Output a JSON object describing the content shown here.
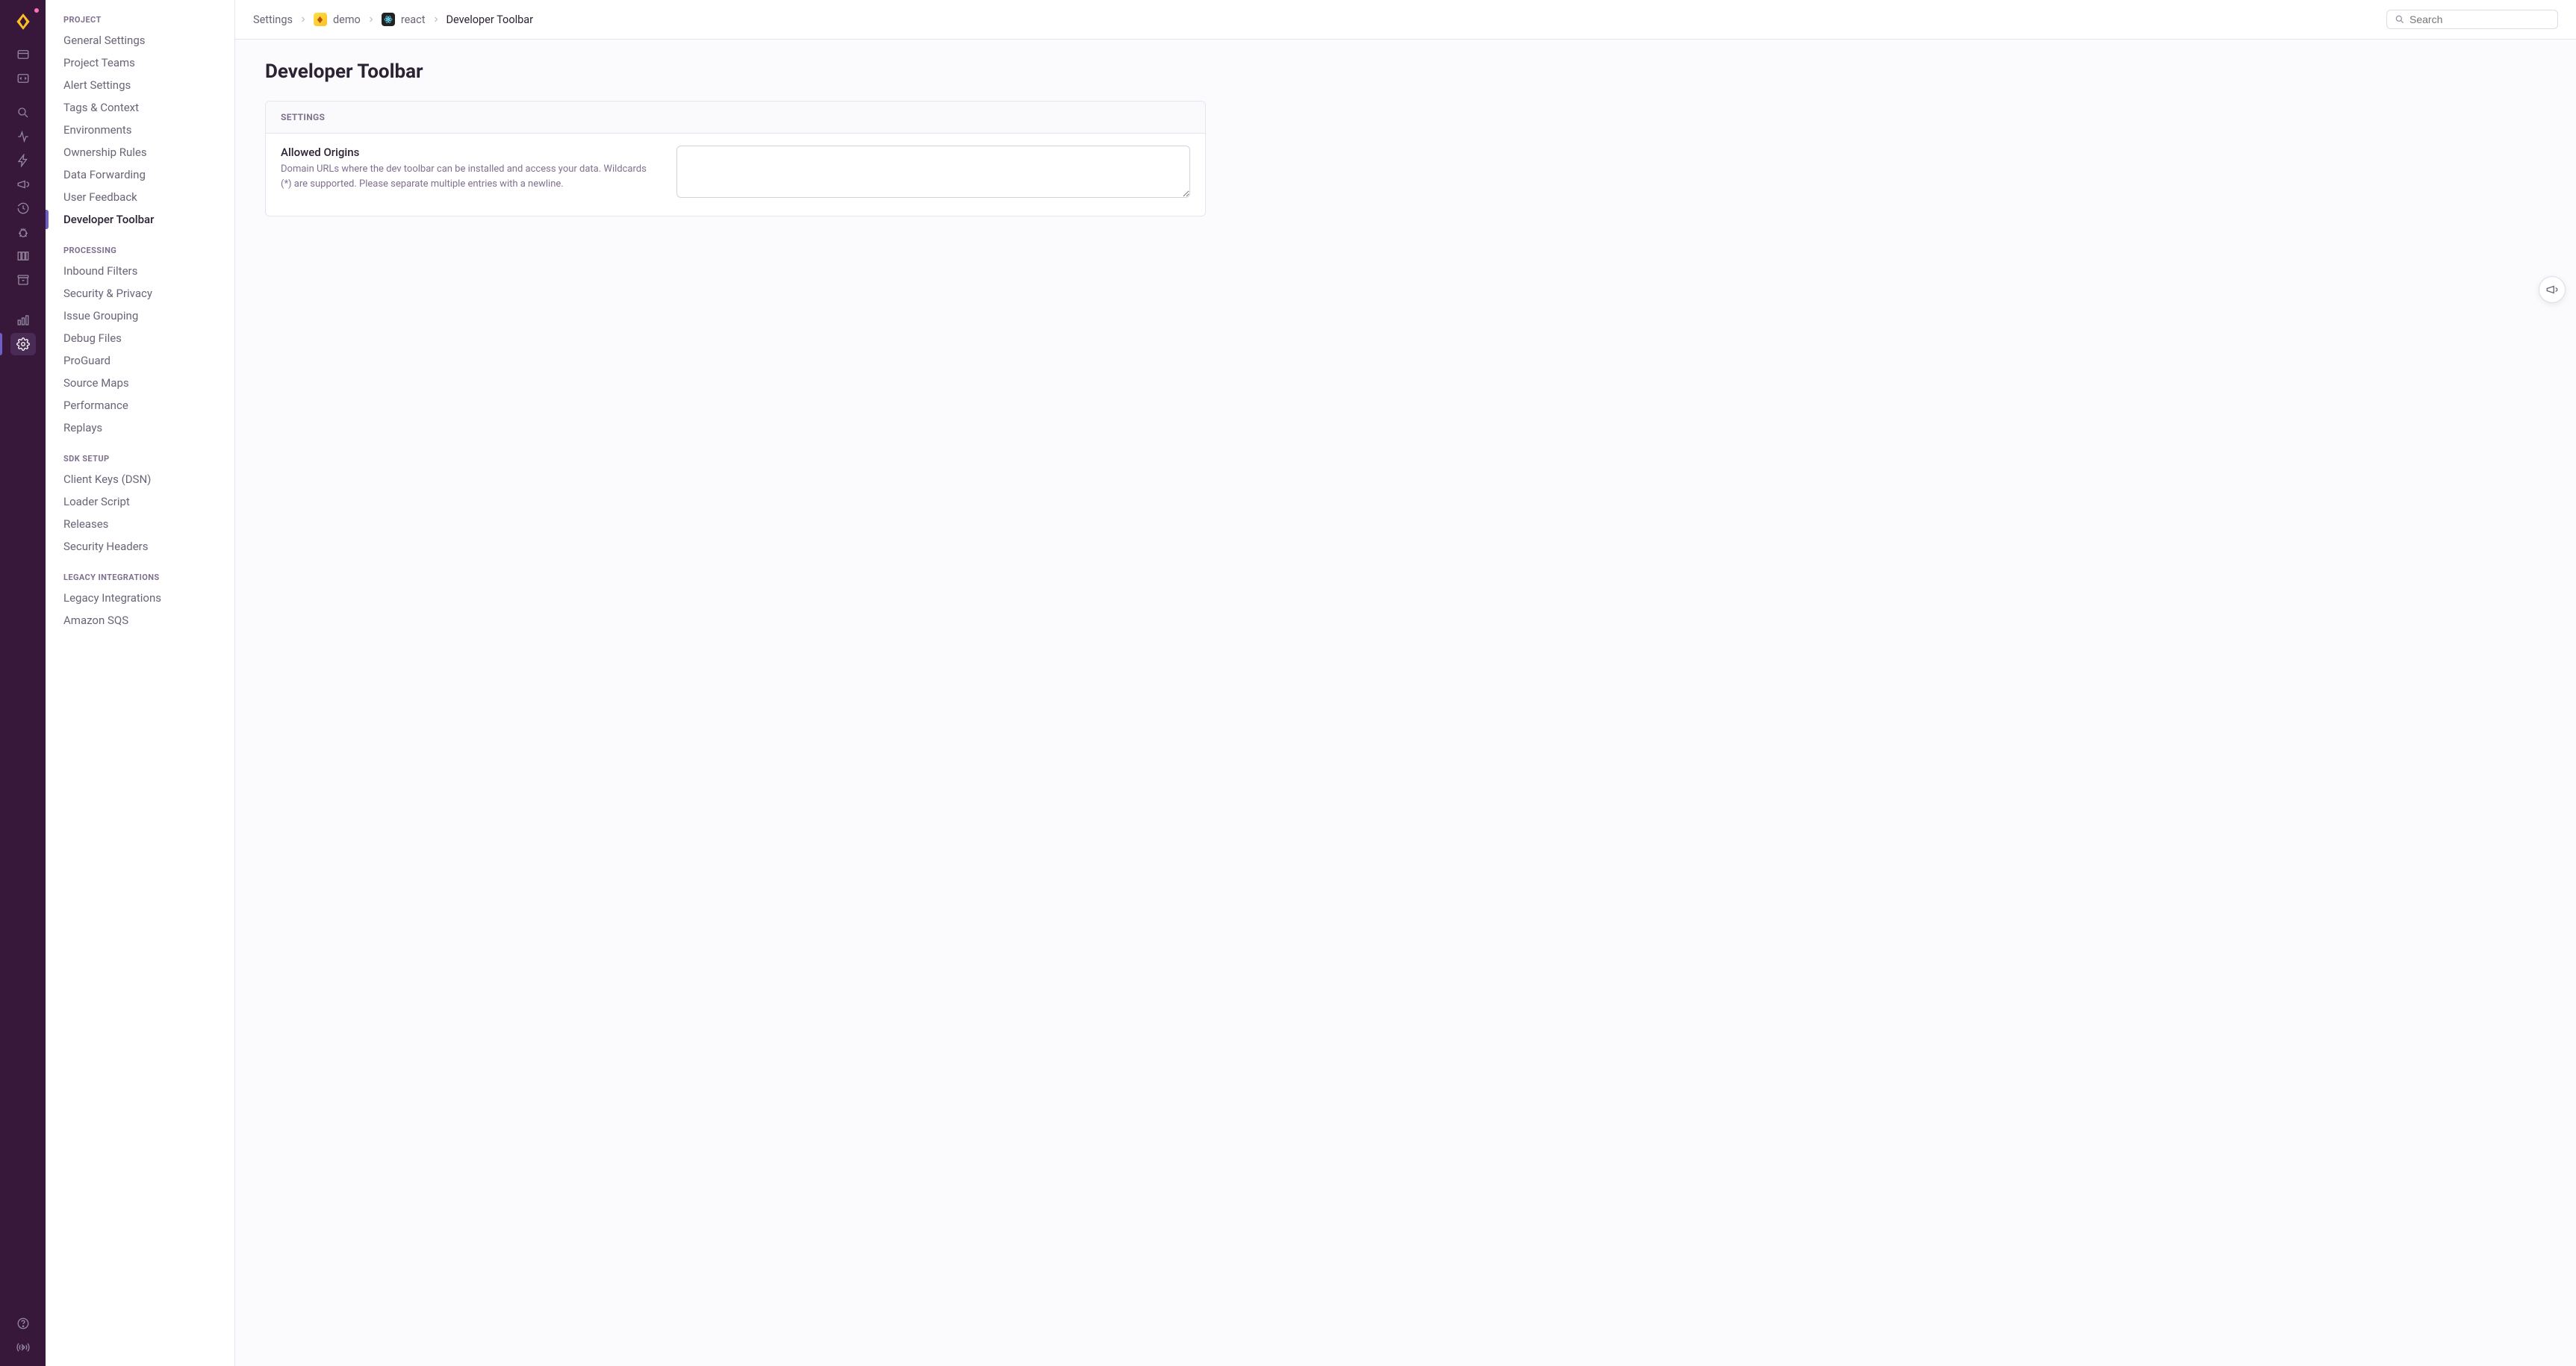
{
  "breadcrumbs": {
    "root": "Settings",
    "org": "demo",
    "project": "react",
    "current": "Developer Toolbar"
  },
  "search": {
    "placeholder": "Search"
  },
  "page": {
    "title": "Developer Toolbar",
    "panel_header": "SETTINGS",
    "field_label": "Allowed Origins",
    "field_help": "Domain URLs where the dev toolbar can be installed and access your data. Wildcards (*) are supported. Please separate multiple entries with a newline.",
    "field_value": ""
  },
  "sidebar": {
    "groups": [
      {
        "title": "PROJECT",
        "items": [
          {
            "label": "General Settings",
            "active": false
          },
          {
            "label": "Project Teams",
            "active": false
          },
          {
            "label": "Alert Settings",
            "active": false
          },
          {
            "label": "Tags & Context",
            "active": false
          },
          {
            "label": "Environments",
            "active": false
          },
          {
            "label": "Ownership Rules",
            "active": false
          },
          {
            "label": "Data Forwarding",
            "active": false
          },
          {
            "label": "User Feedback",
            "active": false
          },
          {
            "label": "Developer Toolbar",
            "active": true
          }
        ]
      },
      {
        "title": "PROCESSING",
        "items": [
          {
            "label": "Inbound Filters",
            "active": false
          },
          {
            "label": "Security & Privacy",
            "active": false
          },
          {
            "label": "Issue Grouping",
            "active": false
          },
          {
            "label": "Debug Files",
            "active": false
          },
          {
            "label": "ProGuard",
            "active": false
          },
          {
            "label": "Source Maps",
            "active": false
          },
          {
            "label": "Performance",
            "active": false
          },
          {
            "label": "Replays",
            "active": false
          }
        ]
      },
      {
        "title": "SDK SETUP",
        "items": [
          {
            "label": "Client Keys (DSN)",
            "active": false
          },
          {
            "label": "Loader Script",
            "active": false
          },
          {
            "label": "Releases",
            "active": false
          },
          {
            "label": "Security Headers",
            "active": false
          }
        ]
      },
      {
        "title": "LEGACY INTEGRATIONS",
        "items": [
          {
            "label": "Legacy Integrations",
            "active": false
          },
          {
            "label": "Amazon SQS",
            "active": false
          }
        ]
      }
    ]
  },
  "rail_icons": [
    {
      "name": "inbox-icon"
    },
    {
      "name": "code-icon"
    },
    {
      "name": "search-icon"
    },
    {
      "name": "activity-icon"
    },
    {
      "name": "bolt-icon"
    },
    {
      "name": "megaphone-icon"
    },
    {
      "name": "history-icon"
    },
    {
      "name": "bug-icon"
    },
    {
      "name": "columns-icon"
    },
    {
      "name": "archive-icon"
    }
  ],
  "rail_icons_bottom": [
    {
      "name": "stats-icon"
    },
    {
      "name": "settings-icon",
      "active": true
    }
  ],
  "rail_footer": [
    {
      "name": "help-icon"
    },
    {
      "name": "broadcast-icon"
    }
  ]
}
